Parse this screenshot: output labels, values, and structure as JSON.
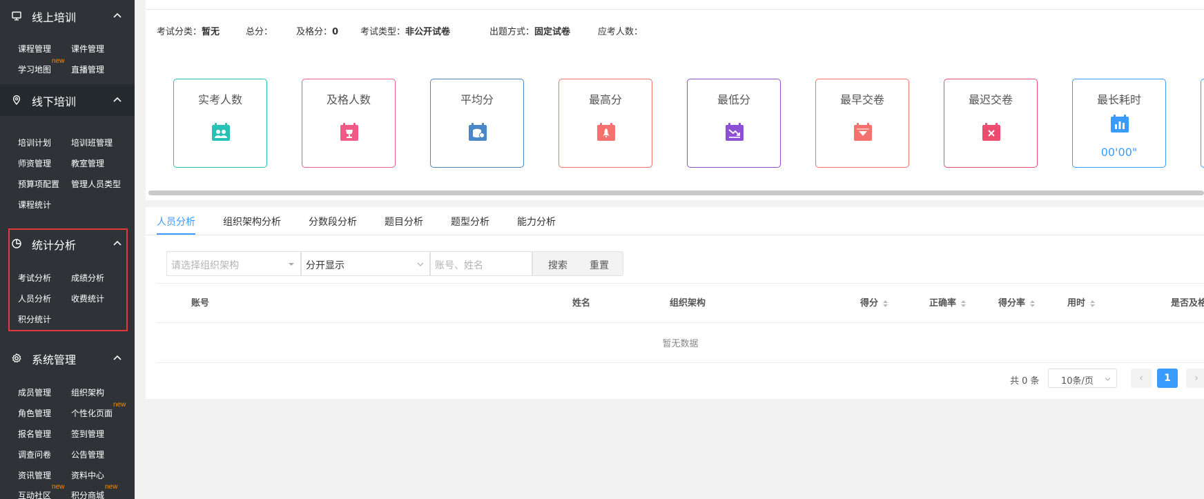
{
  "sidebar": {
    "sections": [
      {
        "title": "线上培训",
        "icon": "monitor-icon",
        "items": [
          "课程管理",
          "课件管理",
          "学习地图",
          "直播管理"
        ],
        "badges": {
          "2": "new"
        }
      },
      {
        "title": "线下培训",
        "icon": "location-pin-icon",
        "items": [
          "培训计划",
          "培训班管理",
          "师资管理",
          "教室管理",
          "预算项配置",
          "管理人员类型",
          "课程统计"
        ]
      },
      {
        "title": "统计分析",
        "icon": "pie-chart-icon",
        "items": [
          "考试分析",
          "成绩分析",
          "人员分析",
          "收费统计",
          "积分统计"
        ]
      },
      {
        "title": "系统管理",
        "icon": "settings-icon",
        "items": [
          "成员管理",
          "组织架构",
          "角色管理",
          "个性化页面",
          "报名管理",
          "签到管理",
          "调查问卷",
          "公告管理",
          "资讯管理",
          "资料中心",
          "互动社区",
          "积分商城"
        ],
        "badges": {
          "3": "new",
          "10": "new",
          "11": "new"
        }
      }
    ]
  },
  "exam_info": {
    "category_label": "考试分类：",
    "category_value": "暂无",
    "total_label": "总分：",
    "total_value": "",
    "pass_label": "及格分：",
    "pass_value": "0",
    "type_label": "考试类型：",
    "type_value": "非公开试卷",
    "method_label": "出题方式：",
    "method_value": "固定试卷",
    "expected_label": "应考人数：",
    "expected_value": ""
  },
  "stat_cards": [
    {
      "label": "实考人数",
      "color": "#28c2b4",
      "icon": "people-calendar-icon",
      "value": ""
    },
    {
      "label": "及格人数",
      "color": "#ef5a86",
      "icon": "trophy-calendar-icon",
      "value": ""
    },
    {
      "label": "平均分",
      "color": "#4a87c6",
      "icon": "coins-calendar-icon",
      "value": ""
    },
    {
      "label": "最高分",
      "color": "#f5716d",
      "icon": "rocket-calendar-icon",
      "value": ""
    },
    {
      "label": "最低分",
      "color": "#8d4fd4",
      "icon": "trend-down-calendar-icon",
      "value": ""
    },
    {
      "label": "最早交卷",
      "color": "#f5716d",
      "icon": "arrow-down-calendar-icon",
      "value": ""
    },
    {
      "label": "最迟交卷",
      "color": "#ec4d6f",
      "icon": "cross-calendar-icon",
      "value": ""
    },
    {
      "label": "最长耗时",
      "color": "#3a9bff",
      "icon": "bar-chart-calendar-icon",
      "value": "00'00\""
    }
  ],
  "tabs": [
    "人员分析",
    "组织架构分析",
    "分数段分析",
    "题目分析",
    "题型分析",
    "能力分析"
  ],
  "active_tab": 0,
  "filters": {
    "org_placeholder": "请选择组织架构",
    "display_mode": "分开显示",
    "keyword_placeholder": "账号、姓名",
    "search_label": "搜索",
    "reset_label": "重置"
  },
  "table": {
    "columns": [
      "账号",
      "姓名",
      "组织架构",
      "得分",
      "正确率",
      "得分率",
      "用时",
      "是否及格"
    ],
    "empty_text": "暂无数据"
  },
  "pagination": {
    "total_text": "共 0 条",
    "page_size": "10条/页",
    "current_page": "1",
    "prev": "‹",
    "next": "›"
  },
  "colors": {
    "sidebar_bg": "#2f3337",
    "accent": "#3a9bff",
    "highlight_border": "#e2393d",
    "badge": "#ff8a00"
  }
}
